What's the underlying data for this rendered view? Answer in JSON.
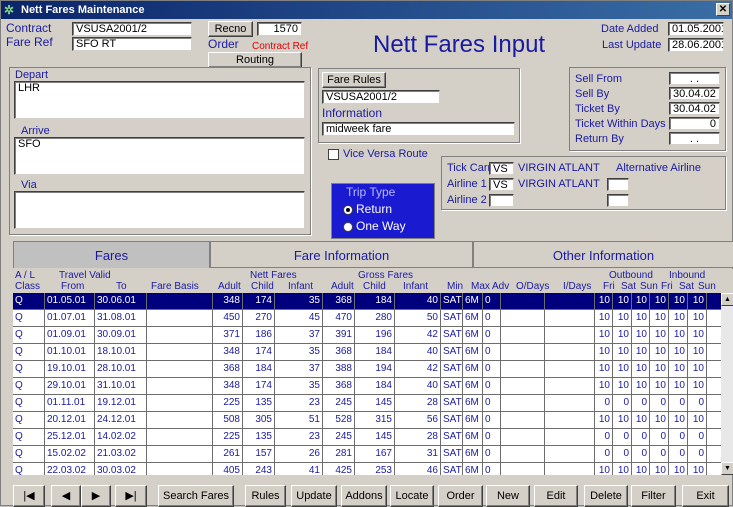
{
  "window": {
    "title": "Nett Fares Maintenance",
    "close": "✕"
  },
  "header": {
    "contract_label": "Contract",
    "contract_value": "VSUSA2001/2",
    "fareref_label": "Fare Ref",
    "fareref_value": "SFO RT",
    "recno_btn": "Recno",
    "recno_value": "1570",
    "order_label": "Order",
    "order_value": "Contract Ref",
    "routing_btn": "Routing",
    "big_title": "Nett Fares Input",
    "date_added_label": "Date Added",
    "date_added_value": "01.05.2001",
    "last_update_label": "Last Update",
    "last_update_value": "28.06.2001"
  },
  "locations": {
    "depart_label": "Depart",
    "depart_value": "LHR",
    "arrive_label": "Arrive",
    "arrive_value": "SFO",
    "via_label": "Via",
    "via_value": ""
  },
  "fare_rules": {
    "button": "Fare Rules",
    "value": "VSUSA2001/2",
    "info_label": "Information",
    "info_value": "midweek fare"
  },
  "vice_versa": {
    "label": "Vice Versa Route",
    "checked": false
  },
  "trip_type": {
    "title": "Trip Type",
    "options": [
      "Return",
      "One Way"
    ],
    "selected": "Return"
  },
  "sell": {
    "sell_from_label": "Sell From",
    "sell_from_value": ". .",
    "sell_by_label": "Sell By",
    "sell_by_value": "30.04.02",
    "ticket_by_label": "Ticket By",
    "ticket_by_value": "30.04.02",
    "ticket_within_label": "Ticket Within Days",
    "ticket_within_value": "0",
    "return_by_label": "Return By",
    "return_by_value": ". ."
  },
  "airlines": {
    "tick_carr_label": "Tick Carr",
    "tick_carr_code": "VS",
    "tick_carr_name": "VIRGIN ATLANT",
    "alt_label": "Alternative Airline",
    "airline1_label": "Airline 1",
    "airline1_code": "VS",
    "airline1_name": "VIRGIN ATLANT",
    "airline2_label": "Airline 2",
    "airline2_code": ""
  },
  "tabs": [
    "Fares",
    "Fare Information",
    "Other Information"
  ],
  "grid_headers": {
    "al": "A / L",
    "class": "Class",
    "travel_valid": "Travel Valid",
    "from": "From",
    "to": "To",
    "fare_basis": "Fare Basis",
    "nett_fares": "Nett Fares",
    "gross_fares": "Gross Fares",
    "adult": "Adult",
    "child": "Child",
    "infant": "Infant",
    "min": "Min",
    "max": "Max",
    "adv": "Adv",
    "odays": "O/Days",
    "idays": "I/Days",
    "outbound": "Outbound",
    "inbound": "Inbound",
    "fri": "Fri",
    "sat": "Sat",
    "sun": "Sun"
  },
  "rows": [
    [
      "Q",
      "01.05.01",
      "30.06.01",
      "",
      "348",
      "174",
      "35",
      "368",
      "184",
      "40",
      "SAT",
      "6M",
      "0",
      "",
      "",
      "10",
      "10",
      "10",
      "10",
      "10",
      "10"
    ],
    [
      "Q",
      "01.07.01",
      "31.08.01",
      "",
      "450",
      "270",
      "45",
      "470",
      "280",
      "50",
      "SAT",
      "6M",
      "0",
      "",
      "",
      "10",
      "10",
      "10",
      "10",
      "10",
      "10"
    ],
    [
      "Q",
      "01.09.01",
      "30.09.01",
      "",
      "371",
      "186",
      "37",
      "391",
      "196",
      "42",
      "SAT",
      "6M",
      "0",
      "",
      "",
      "10",
      "10",
      "10",
      "10",
      "10",
      "10"
    ],
    [
      "Q",
      "01.10.01",
      "18.10.01",
      "",
      "348",
      "174",
      "35",
      "368",
      "184",
      "40",
      "SAT",
      "6M",
      "0",
      "",
      "",
      "10",
      "10",
      "10",
      "10",
      "10",
      "10"
    ],
    [
      "Q",
      "19.10.01",
      "28.10.01",
      "",
      "368",
      "184",
      "37",
      "388",
      "194",
      "42",
      "SAT",
      "6M",
      "0",
      "",
      "",
      "10",
      "10",
      "10",
      "10",
      "10",
      "10"
    ],
    [
      "Q",
      "29.10.01",
      "31.10.01",
      "",
      "348",
      "174",
      "35",
      "368",
      "184",
      "40",
      "SAT",
      "6M",
      "0",
      "",
      "",
      "10",
      "10",
      "10",
      "10",
      "10",
      "10"
    ],
    [
      "Q",
      "01.11.01",
      "19.12.01",
      "",
      "225",
      "135",
      "23",
      "245",
      "145",
      "28",
      "SAT",
      "6M",
      "0",
      "",
      "",
      "0",
      "0",
      "0",
      "0",
      "0",
      "0"
    ],
    [
      "Q",
      "20.12.01",
      "24.12.01",
      "",
      "508",
      "305",
      "51",
      "528",
      "315",
      "56",
      "SAT",
      "6M",
      "0",
      "",
      "",
      "10",
      "10",
      "10",
      "10",
      "10",
      "10"
    ],
    [
      "Q",
      "25.12.01",
      "14.02.02",
      "",
      "225",
      "135",
      "23",
      "245",
      "145",
      "28",
      "SAT",
      "6M",
      "0",
      "",
      "",
      "0",
      "0",
      "0",
      "0",
      "0",
      "0"
    ],
    [
      "Q",
      "15.02.02",
      "21.03.02",
      "",
      "261",
      "157",
      "26",
      "281",
      "167",
      "31",
      "SAT",
      "6M",
      "0",
      "",
      "",
      "0",
      "0",
      "0",
      "0",
      "0",
      "0"
    ],
    [
      "Q",
      "22.03.02",
      "30.03.02",
      "",
      "405",
      "243",
      "41",
      "425",
      "253",
      "46",
      "SAT",
      "6M",
      "0",
      "",
      "",
      "10",
      "10",
      "10",
      "10",
      "10",
      "10"
    ]
  ],
  "nav": {
    "first": "|◀",
    "prev": "◀",
    "next": "▶",
    "last": "▶|",
    "search": "Search Fares",
    "rules": "Rules",
    "update": "Update",
    "addons": "Addons",
    "locate": "Locate",
    "order": "Order",
    "new": "New",
    "edit": "Edit",
    "delete": "Delete",
    "filter": "Filter",
    "exit": "Exit"
  }
}
